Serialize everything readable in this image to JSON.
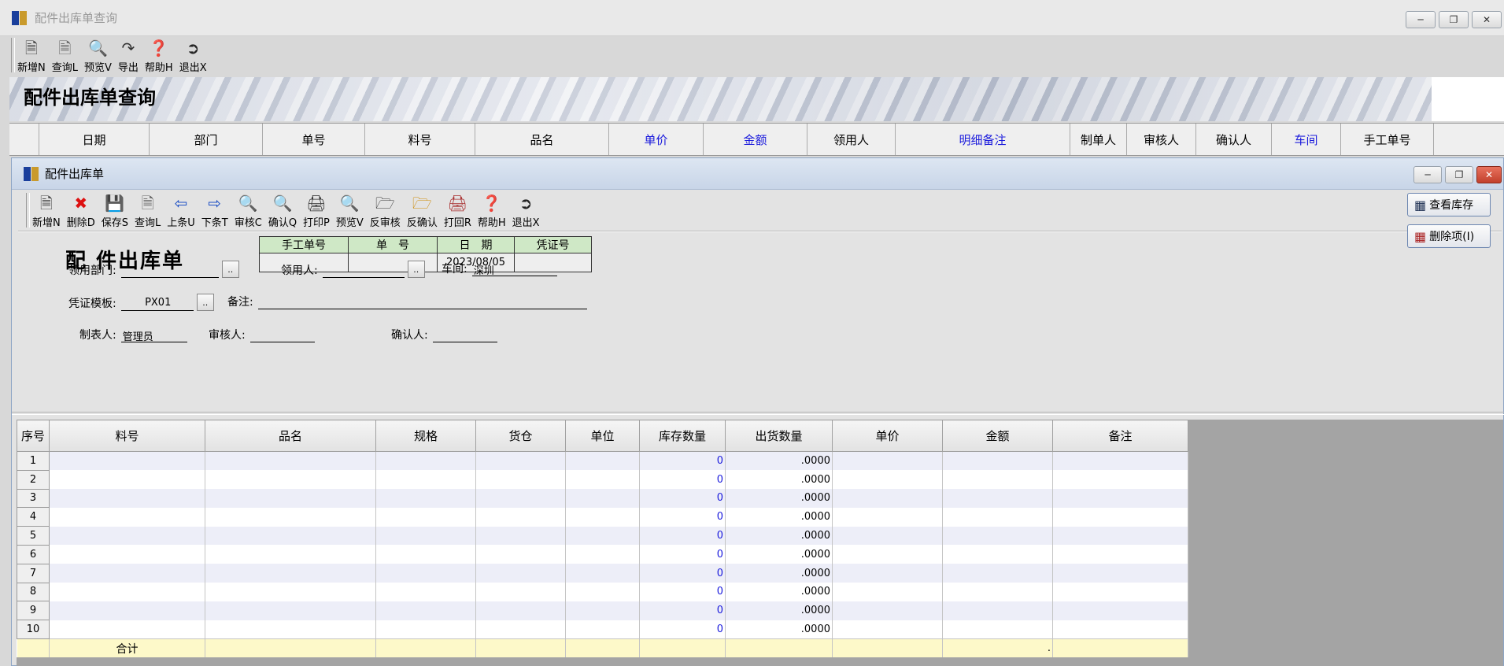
{
  "outer": {
    "title": "配件出库单查询",
    "toolbar": [
      {
        "label": "新增N",
        "icon": "new-doc-icon"
      },
      {
        "label": "查询L",
        "icon": "search-doc-icon"
      },
      {
        "label": "预览V",
        "icon": "magnifier-icon"
      },
      {
        "label": "导出",
        "icon": "export-icon"
      },
      {
        "label": "帮助H",
        "icon": "help-icon"
      },
      {
        "label": "退出X",
        "icon": "exit-icon"
      }
    ],
    "banner_title": "配件出库单查询",
    "columns": [
      "日期",
      "部门",
      "单号",
      "料号",
      "品名",
      "单价",
      "金额",
      "领用人",
      "明细备注",
      "制单人",
      "审核人",
      "确认人",
      "车间",
      "手工单号"
    ],
    "blue_columns": [
      "单价",
      "金额",
      "明细备注",
      "车间"
    ]
  },
  "inner": {
    "title": "配件出库单",
    "toolbar": [
      {
        "label": "新增N",
        "icon": "new-doc-icon"
      },
      {
        "label": "删除D",
        "icon": "delete-icon"
      },
      {
        "label": "保存S",
        "icon": "save-icon"
      },
      {
        "label": "查询L",
        "icon": "search-doc-icon"
      },
      {
        "label": "上条U",
        "icon": "arrow-left-icon"
      },
      {
        "label": "下条T",
        "icon": "arrow-right-icon"
      },
      {
        "label": "审核C",
        "icon": "magnifier-icon"
      },
      {
        "label": "确认Q",
        "icon": "magnifier-icon"
      },
      {
        "label": "打印P",
        "icon": "printer-icon"
      },
      {
        "label": "预览V",
        "icon": "magnifier-icon"
      },
      {
        "label": "反审核",
        "icon": "unapprove-icon"
      },
      {
        "label": "反确认",
        "icon": "unconfirm-icon"
      },
      {
        "label": "打回R",
        "icon": "return-icon"
      },
      {
        "label": "帮助H",
        "icon": "help-icon"
      },
      {
        "label": "退出X",
        "icon": "exit-icon"
      }
    ],
    "form_title": "配 件出库单",
    "info": {
      "headers": [
        "手工单号",
        "单　号",
        "日　期",
        "凭证号"
      ],
      "manual_no": "",
      "order_no": "",
      "date": "2023/08/05",
      "voucher_no": ""
    },
    "fields": {
      "dept_label": "领用部门:",
      "dept_value": "",
      "receiver_label": "领用人:",
      "receiver_value": "",
      "workshop_label": "车间:",
      "workshop_value": "深圳",
      "template_label": "凭证模板:",
      "template_value": "PX01",
      "remark_label": "备注:",
      "remark_value": "",
      "creator_label": "制表人:",
      "creator_value": "管理员",
      "auditor_label": "审核人:",
      "auditor_value": "",
      "confirmer_label": "确认人:",
      "confirmer_value": "",
      "dots": ".."
    },
    "side_buttons": {
      "view_stock": "查看库存",
      "delete_item": "删除项(I)"
    },
    "grid": {
      "columns": [
        "序号",
        "料号",
        "品名",
        "规格",
        "货仓",
        "单位",
        "库存数量",
        "出货数量",
        "单价",
        "金额",
        "备注"
      ],
      "rows": [
        {
          "no": "1",
          "stock": "0",
          "qty": ".0000"
        },
        {
          "no": "2",
          "stock": "0",
          "qty": ".0000"
        },
        {
          "no": "3",
          "stock": "0",
          "qty": ".0000"
        },
        {
          "no": "4",
          "stock": "0",
          "qty": ".0000"
        },
        {
          "no": "5",
          "stock": "0",
          "qty": ".0000"
        },
        {
          "no": "6",
          "stock": "0",
          "qty": ".0000"
        },
        {
          "no": "7",
          "stock": "0",
          "qty": ".0000"
        },
        {
          "no": "8",
          "stock": "0",
          "qty": ".0000"
        },
        {
          "no": "9",
          "stock": "0",
          "qty": ".0000"
        },
        {
          "no": "10",
          "stock": "0",
          "qty": ".0000"
        }
      ],
      "total_label": "合计",
      "total_amount": "."
    }
  },
  "colors": {
    "link_blue": "#1a1adc",
    "header_green": "#cfe8c6",
    "total_yellow": "#fdf9c9"
  }
}
